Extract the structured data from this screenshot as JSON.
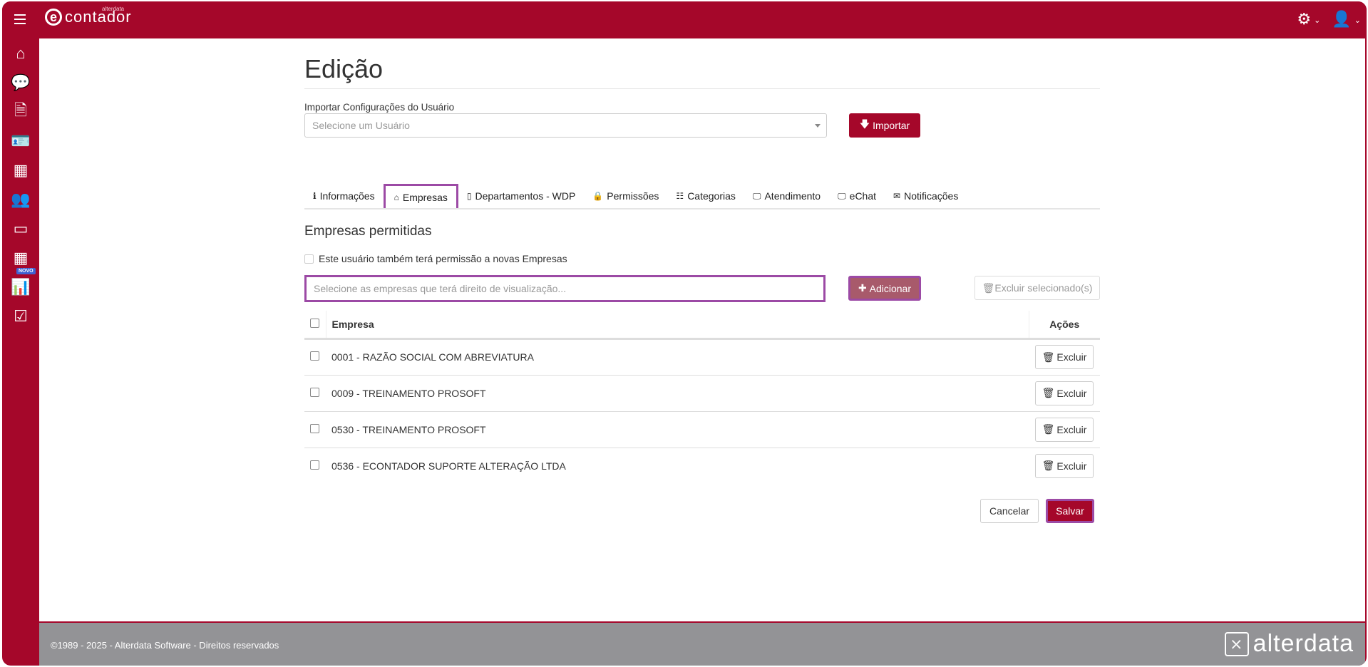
{
  "header": {
    "logo_text": "contador",
    "logo_small": "alterdata",
    "logo_letter": "e"
  },
  "sidebar": {
    "items": [
      {
        "icon": "home-icon",
        "glyph": "⌂"
      },
      {
        "icon": "chat-icon",
        "glyph": "💬"
      },
      {
        "icon": "document-icon",
        "glyph": "🗎"
      },
      {
        "icon": "contact-card-icon",
        "glyph": "🪪"
      },
      {
        "icon": "building-icon",
        "glyph": "▦"
      },
      {
        "icon": "users-icon",
        "glyph": "👥"
      },
      {
        "icon": "credit-card-icon",
        "glyph": "▭"
      },
      {
        "icon": "calculator-icon",
        "glyph": "▦"
      },
      {
        "icon": "bar-chart-icon",
        "glyph": "📊"
      },
      {
        "icon": "checkbox-icon",
        "glyph": "☑"
      }
    ],
    "novo_badge": "NOVO"
  },
  "page": {
    "title": "Edição",
    "import_label": "Importar Configurações do Usuário",
    "import_placeholder": "Selecione um Usuário",
    "import_button": "Importar"
  },
  "tabs": [
    {
      "label": "Informações",
      "glyph": "ℹ"
    },
    {
      "label": "Empresas",
      "glyph": "⌂"
    },
    {
      "label": "Departamentos - WDP",
      "glyph": "▯"
    },
    {
      "label": "Permissões",
      "glyph": "🔒"
    },
    {
      "label": "Categorias",
      "glyph": "☷"
    },
    {
      "label": "Atendimento",
      "glyph": "🖵"
    },
    {
      "label": "eChat",
      "glyph": "🖵"
    },
    {
      "label": "Notificações",
      "glyph": "✉"
    }
  ],
  "section": {
    "title": "Empresas permitidas",
    "checkbox_label": "Este usuário também terá permissão a novas Empresas",
    "input_placeholder": "Selecione as empresas que terá direito de visualização...",
    "add_button": "Adicionar",
    "delete_selected_button": "Excluir selecionado(s)"
  },
  "table": {
    "headers": [
      "Empresa",
      "Ações"
    ],
    "rows": [
      {
        "empresa": "0001 - RAZÃO SOCIAL COM ABREVIATURA",
        "action": "Excluir"
      },
      {
        "empresa": "0009 - TREINAMENTO PROSOFT",
        "action": "Excluir"
      },
      {
        "empresa": "0530 - TREINAMENTO PROSOFT",
        "action": "Excluir"
      },
      {
        "empresa": "0536 - ECONTADOR SUPORTE ALTERAÇÃO LTDA",
        "action": "Excluir"
      }
    ]
  },
  "actions": {
    "cancel": "Cancelar",
    "save": "Salvar"
  },
  "footer": {
    "copyright": "©1989 - 2025 - Alterdata Software - Direitos reservados",
    "brand": "alterdata"
  },
  "colors": {
    "brand": "#a5072a",
    "footer": "#939396",
    "highlight": "#9c4aa5"
  }
}
